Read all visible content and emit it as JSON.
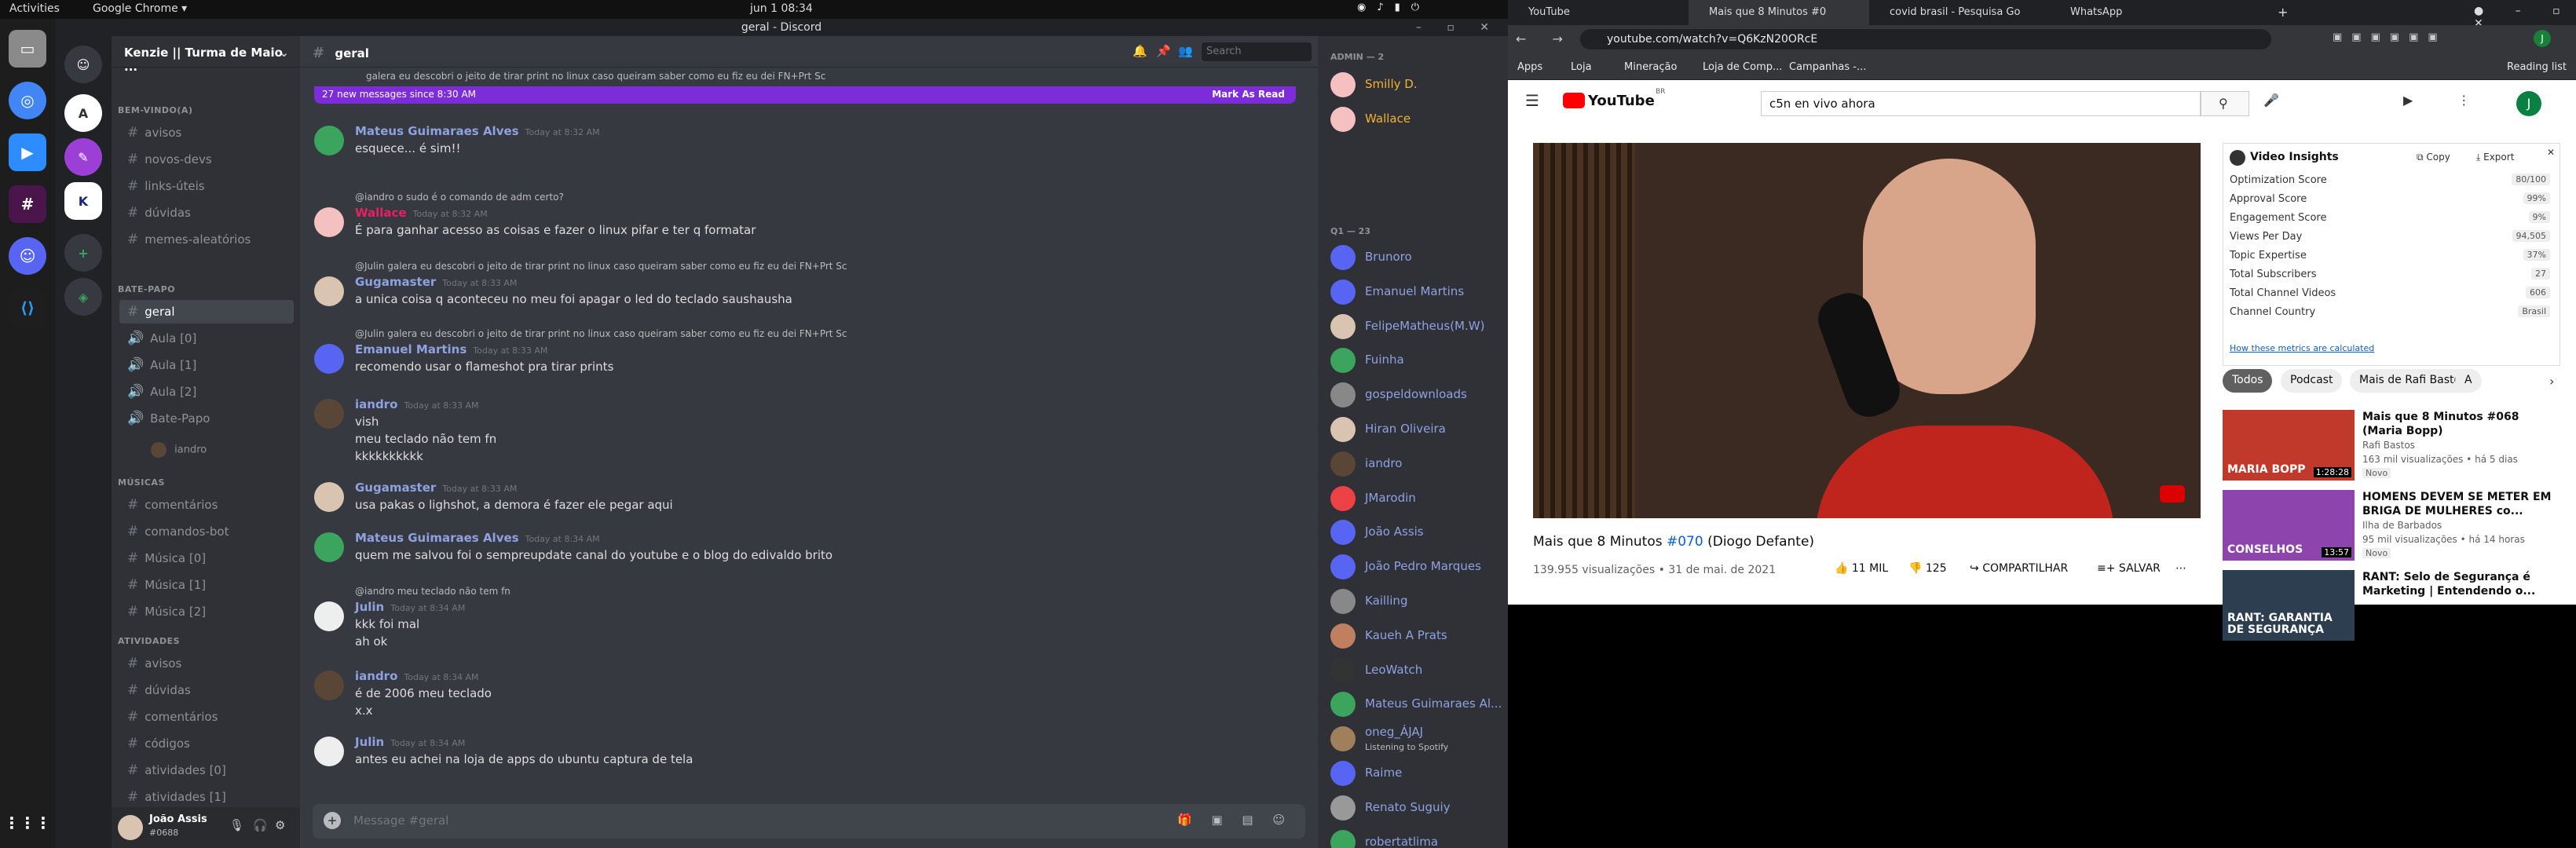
{
  "topbar": {
    "activities": "Activities",
    "app": "Google Chrome ▾",
    "clock": "jun 1  08:34"
  },
  "discord": {
    "window_title": "geral - Discord",
    "server_name": "Kenzie || Turma de Maio ...",
    "categories": [
      "BEM-VINDO(A)",
      "BATE-PAPO",
      "MÚSICAS",
      "ATIVIDADES"
    ],
    "channels_welcome": [
      "avisos",
      "novos-devs",
      "links-úteis",
      "dúvidas",
      "memes-aleatórios"
    ],
    "channels_chat": [
      "geral",
      "Aula [0]",
      "Aula [1]",
      "Aula [2]",
      "Bate-Papo"
    ],
    "voice_user": "iandro",
    "channels_music": [
      "comentários",
      "comandos-bot",
      "Música [0]",
      "Música [1]",
      "Música [2]"
    ],
    "channels_activities": [
      "avisos",
      "dúvidas",
      "comentários",
      "códigos",
      "atividades [0]",
      "atividades [1]"
    ],
    "user": {
      "name": "João Assis",
      "tag": "#0688"
    },
    "channel_title": "geral",
    "search_placeholder": "Search",
    "new_messages": "27 new messages since 8:30 AM",
    "mark_as_read": "Mark As Read",
    "input_placeholder": "Message #geral",
    "messages": [
      {
        "author": "Mateus Guimaraes Alves",
        "time": "Today at 8:32 AM",
        "reply": "",
        "lines": [
          "esquece... é sim!!"
        ],
        "color": "#8ea1e1",
        "avatar": "#3ba55d"
      },
      {
        "author": "Wallace",
        "time": "Today at 8:32 AM",
        "reply": "@iandro o sudo é o comando de adm certo?",
        "lines": [
          "É para ganhar acesso as coisas e fazer o linux pifar e ter q formatar"
        ],
        "color": "#e91e63",
        "avatar": "#f5c0c0"
      },
      {
        "author": "Gugamaster",
        "time": "Today at 8:33 AM",
        "reply": "@Julin galera eu descobri o jeito de tirar print no linux caso queiram saber como eu fiz eu dei FN+Prt Sc",
        "lines": [
          "a unica coisa q aconteceu no meu foi apagar o led do teclado saushausha"
        ],
        "color": "#8ea1e1",
        "avatar": "#d8c4b0"
      },
      {
        "author": "Emanuel Martins",
        "time": "Today at 8:33 AM",
        "reply": "@Julin galera eu descobri o jeito de tirar print no linux caso queiram saber como eu fiz eu dei FN+Prt Sc",
        "lines": [
          "recomendo usar o flameshot pra tirar prints"
        ],
        "color": "#8ea1e1",
        "avatar": "#5865f2"
      },
      {
        "author": "iandro",
        "time": "Today at 8:33 AM",
        "reply": "",
        "lines": [
          "vish",
          "meu teclado não tem fn",
          "kkkkkkkkkk"
        ],
        "color": "#8ea1e1",
        "avatar": "#5a4636"
      },
      {
        "author": "Gugamaster",
        "time": "Today at 8:33 AM",
        "reply": "",
        "lines": [
          "usa pakas o lighshot, a demora é fazer ele pegar aqui"
        ],
        "color": "#8ea1e1",
        "avatar": "#d8c4b0"
      },
      {
        "author": "Mateus Guimaraes Alves",
        "time": "Today at 8:34 AM",
        "reply": "",
        "lines": [
          "quem me salvou foi o sempreupdate canal do youtube e o blog do edivaldo brito"
        ],
        "color": "#8ea1e1",
        "avatar": "#3ba55d"
      },
      {
        "author": "Julin",
        "time": "Today at 8:34 AM",
        "reply": "@iandro meu teclado não tem fn",
        "lines": [
          "kkk foi mal",
          "ah ok"
        ],
        "color": "#8ea1e1",
        "avatar": "#eeeeee"
      },
      {
        "author": "iandro",
        "time": "Today at 8:34 AM",
        "reply": "",
        "lines": [
          "é de 2006 meu teclado",
          "x.x"
        ],
        "color": "#8ea1e1",
        "avatar": "#5a4636"
      },
      {
        "author": "Julin",
        "time": "Today at 8:34 AM",
        "reply": "",
        "lines": [
          "antes eu achei na loja de apps do ubuntu captura de tela"
        ],
        "color": "#8ea1e1",
        "avatar": "#eeeeee"
      }
    ],
    "top_partial": "galera eu descobri o jeito de tirar print no linux caso queiram saber como eu fiz eu dei FN+Prt Sc",
    "admin_header": "ADMIN — 2",
    "admins": [
      {
        "name": "Smilly D.",
        "color": "#f0b232"
      },
      {
        "name": "Wallace",
        "color": "#f0b232"
      }
    ],
    "members_header": "Q1 — 23",
    "members": [
      {
        "name": "Brunoro",
        "status": ""
      },
      {
        "name": "Emanuel Martins",
        "status": ""
      },
      {
        "name": "FelipeMatheus(M.W)",
        "status": ""
      },
      {
        "name": "Fuinha",
        "status": ""
      },
      {
        "name": "gospeldownloads",
        "status": ""
      },
      {
        "name": "Hiran Oliveira",
        "status": ""
      },
      {
        "name": "iandro",
        "status": ""
      },
      {
        "name": "JMarodin",
        "status": ""
      },
      {
        "name": "João Assis",
        "status": ""
      },
      {
        "name": "João Pedro Marques",
        "status": ""
      },
      {
        "name": "Kailling",
        "status": ""
      },
      {
        "name": "Kaueh A Prats",
        "status": ""
      },
      {
        "name": "LeoWatch",
        "status": ""
      },
      {
        "name": "Mateus Guimaraes Al...",
        "status": ""
      },
      {
        "name": "oneg_ÁJAJ",
        "status": "Listening to Spotify"
      },
      {
        "name": "Raime",
        "status": ""
      },
      {
        "name": "Renato Suguiy",
        "status": ""
      },
      {
        "name": "robertatlima",
        "status": ""
      }
    ]
  },
  "chrome": {
    "tabs": [
      "YouTube",
      "Mais que 8 Minutos #0",
      "covid brasil - Pesquisa Go",
      "WhatsApp"
    ],
    "url": "youtube.com/watch?v=Q6KzN20ORcE",
    "bookmarks": [
      "Apps",
      "Loja",
      "Mineração",
      "Loja de Comp...",
      "Campanhas -..."
    ],
    "reading_list": "Reading list"
  },
  "youtube": {
    "logo": "YouTube",
    "country": "BR",
    "search_value": "c5n en vivo ahora",
    "avatar_letter": "J",
    "video_title_prefix": "Mais que 8 Minutos",
    "video_title_link": "#070",
    "video_title_suffix": "(Diogo Defante)",
    "views_date": "139.955 visualizações • 31 de mai. de 2021",
    "likes": "11 MIL",
    "dislikes": "125",
    "share": "COMPARTILHAR",
    "save": "SALVAR",
    "insights": {
      "title": "Video Insights",
      "copy": "Copy",
      "export": "Export",
      "rows": [
        {
          "k": "Optimization Score",
          "v": "80/100"
        },
        {
          "k": "Approval Score",
          "v": "99%"
        },
        {
          "k": "Engagement Score",
          "v": "9%"
        },
        {
          "k": "Views Per Day",
          "v": "94,505"
        },
        {
          "k": "Topic Expertise",
          "v": "37%"
        },
        {
          "k": "Total Subscribers",
          "v": "27"
        },
        {
          "k": "Total Channel Videos",
          "v": "606"
        },
        {
          "k": "Channel Country",
          "v": "Brasil"
        }
      ],
      "link": "How these metrics are calculated"
    },
    "chips": [
      "Todos",
      "Podcast",
      "Mais de Rafi Bastos",
      "A"
    ],
    "recs": [
      {
        "title": "Mais que 8 Minutos #068 (Maria Bopp)",
        "channel": "Rafi Bastos",
        "views": "163 mil visualizações • há 5 dias",
        "badge": "Novo",
        "duration": "1:28:28",
        "thumb_text": "MARIA BOPP",
        "thumb": "#c0392b"
      },
      {
        "title": "HOMENS DEVEM SE METER EM BRIGA DE MULHERES co...",
        "channel": "Ilha de Barbados",
        "views": "95 mil visualizações • há 14 horas",
        "badge": "Novo",
        "duration": "13:57",
        "thumb_text": "CONSELHOS",
        "thumb": "#8e44ad"
      },
      {
        "title": "RANT: Selo de Segurança é Marketing | Entendendo o...",
        "channel": "",
        "views": "",
        "badge": "",
        "duration": "",
        "thumb_text": "RANT: GARANTIA DE SEGURANÇA",
        "thumb": "#2c3e50"
      }
    ]
  }
}
